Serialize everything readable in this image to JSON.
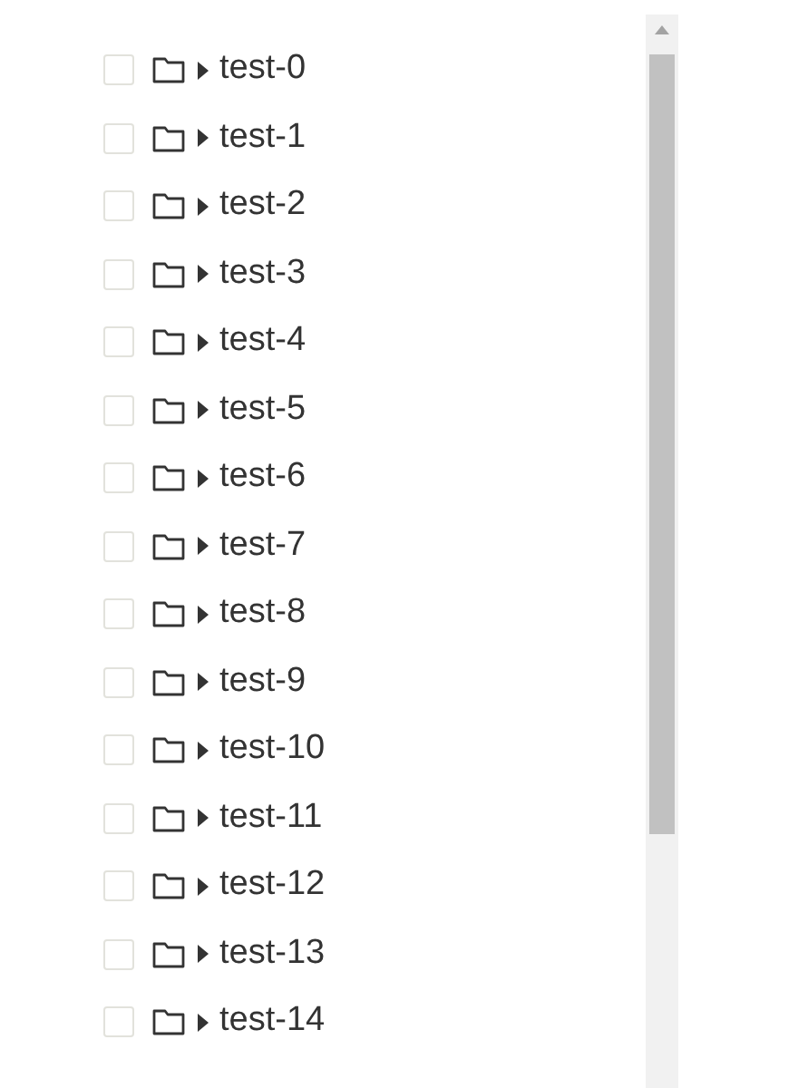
{
  "tree": {
    "items": [
      {
        "label": "test-0",
        "checked": false,
        "expanded": false
      },
      {
        "label": "test-1",
        "checked": false,
        "expanded": false
      },
      {
        "label": "test-2",
        "checked": false,
        "expanded": false
      },
      {
        "label": "test-3",
        "checked": false,
        "expanded": false
      },
      {
        "label": "test-4",
        "checked": false,
        "expanded": false
      },
      {
        "label": "test-5",
        "checked": false,
        "expanded": false
      },
      {
        "label": "test-6",
        "checked": false,
        "expanded": false
      },
      {
        "label": "test-7",
        "checked": false,
        "expanded": false
      },
      {
        "label": "test-8",
        "checked": false,
        "expanded": false
      },
      {
        "label": "test-9",
        "checked": false,
        "expanded": false
      },
      {
        "label": "test-10",
        "checked": false,
        "expanded": false
      },
      {
        "label": "test-11",
        "checked": false,
        "expanded": false
      },
      {
        "label": "test-12",
        "checked": false,
        "expanded": false
      },
      {
        "label": "test-13",
        "checked": false,
        "expanded": false
      },
      {
        "label": "test-14",
        "checked": false,
        "expanded": false
      }
    ]
  }
}
